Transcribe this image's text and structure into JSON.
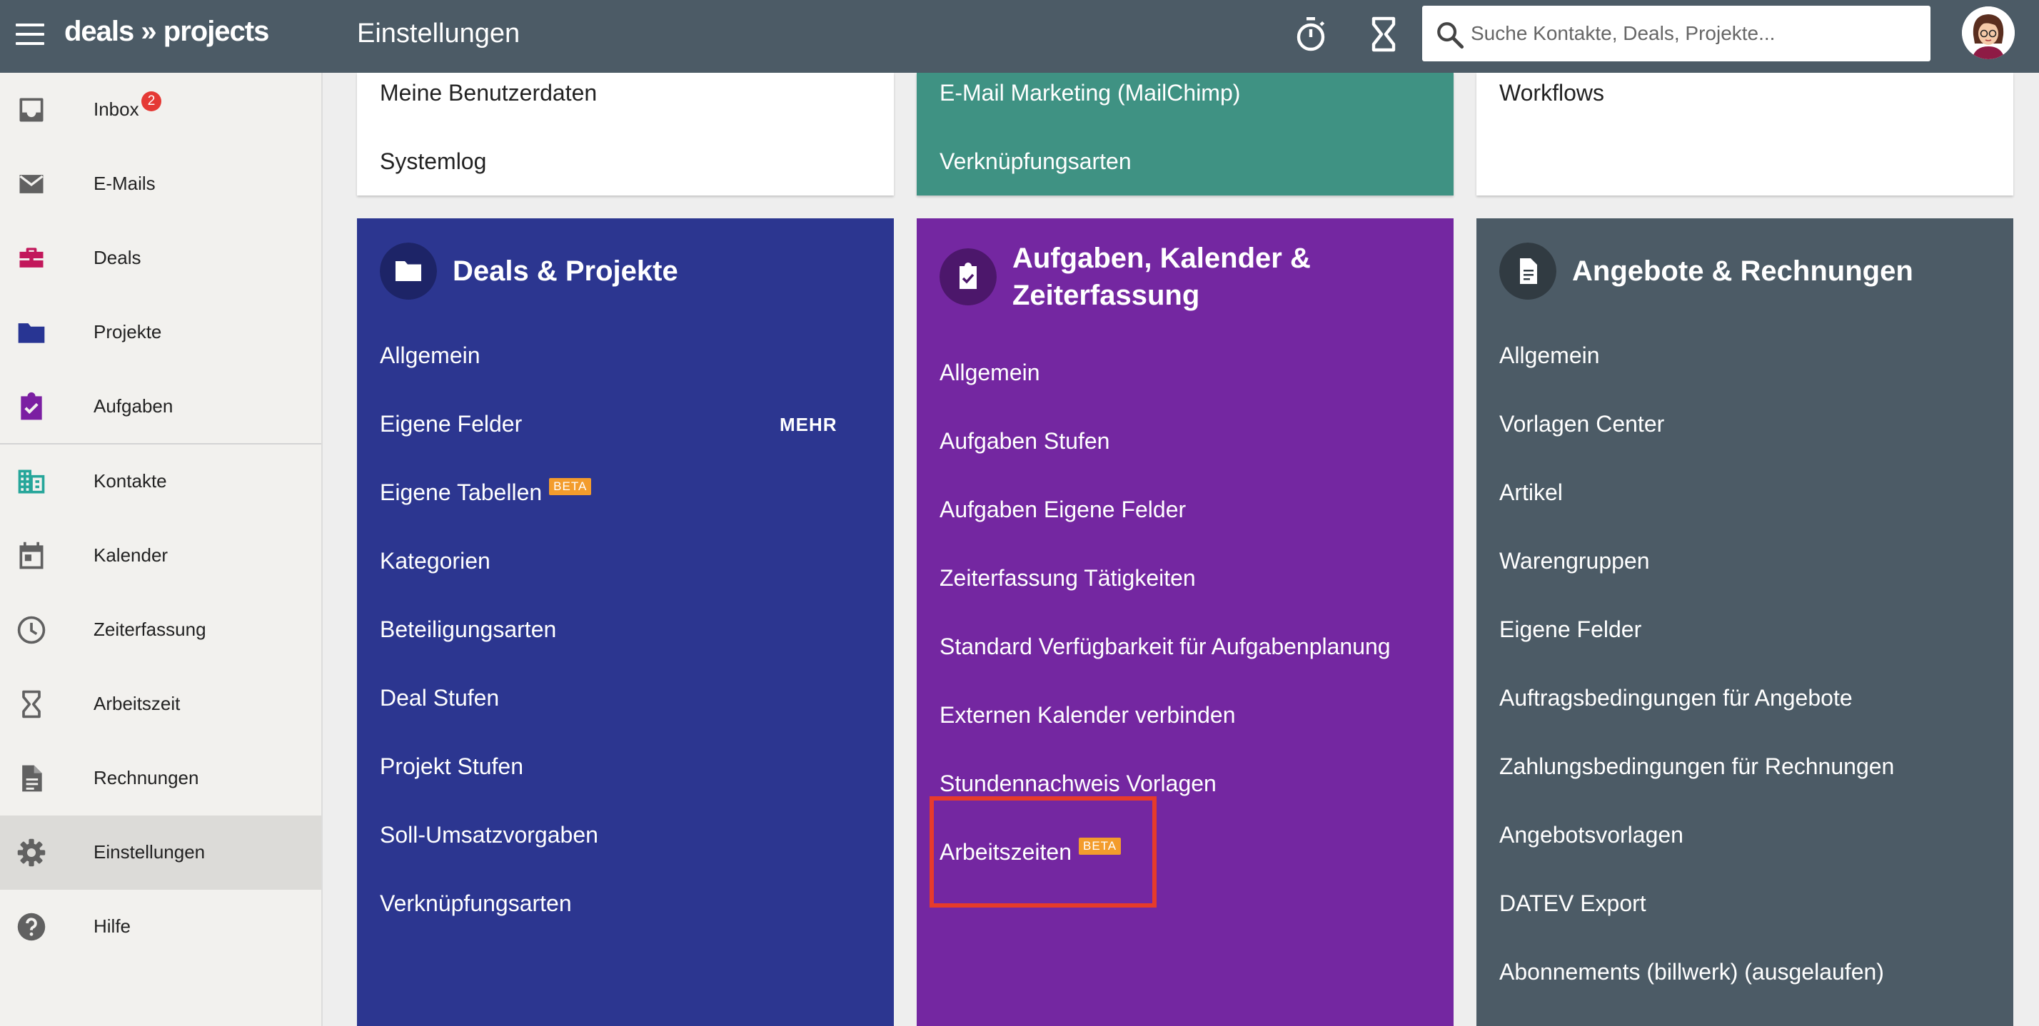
{
  "header": {
    "logo": "deals » projects",
    "title": "Einstellungen",
    "search_placeholder": "Suche Kontakte, Deals, Projekte..."
  },
  "sidebar": {
    "items": [
      {
        "label": "Inbox",
        "icon": "inbox-icon",
        "badge": "2"
      },
      {
        "label": "E-Mails",
        "icon": "mail-icon"
      },
      {
        "label": "Deals",
        "icon": "briefcase-icon"
      },
      {
        "label": "Projekte",
        "icon": "folder-icon"
      },
      {
        "label": "Aufgaben",
        "icon": "task-check-icon"
      },
      {
        "label": "Kontakte",
        "icon": "building-icon"
      },
      {
        "label": "Kalender",
        "icon": "calendar-icon"
      },
      {
        "label": "Zeiterfassung",
        "icon": "clock-icon"
      },
      {
        "label": "Arbeitszeit",
        "icon": "hourglass-icon"
      },
      {
        "label": "Rechnungen",
        "icon": "document-icon"
      },
      {
        "label": "Einstellungen",
        "icon": "gear-icon",
        "active": true
      },
      {
        "label": "Hilfe",
        "icon": "help-icon"
      }
    ]
  },
  "top_cards": {
    "col1": [
      "Meine Benutzerdaten",
      "Systemlog"
    ],
    "col2": [
      "E-Mail Marketing (MailChimp)",
      "Verknüpfungsarten"
    ],
    "col3": [
      "Workflows"
    ]
  },
  "cards": {
    "deals": {
      "title": "Deals & Projekte",
      "icon": "folder-icon",
      "mehr": "MEHR",
      "beta": "BETA",
      "items": [
        "Allgemein",
        "Eigene Felder",
        "Eigene Tabellen",
        "Kategorien",
        "Beteiligungsarten",
        "Deal Stufen",
        "Projekt Stufen",
        "Soll-Umsatzvorgaben",
        "Verknüpfungsarten"
      ]
    },
    "tasks": {
      "title_line1": "Aufgaben, Kalender &",
      "title_line2": "Zeiterfassung",
      "icon": "task-check-icon",
      "beta": "BETA",
      "items": [
        "Allgemein",
        "Aufgaben Stufen",
        "Aufgaben Eigene Felder",
        "Zeiterfassung Tätigkeiten",
        "Standard Verfügbarkeit für Aufgabenplanung",
        "Externen Kalender verbinden",
        "Stundennachweis Vorlagen",
        "Arbeitszeiten"
      ]
    },
    "offers": {
      "title": "Angebote & Rechnungen",
      "icon": "document-icon",
      "items": [
        "Allgemein",
        "Vorlagen Center",
        "Artikel",
        "Warengruppen",
        "Eigene Felder",
        "Auftragsbedingungen für Angebote",
        "Zahlungsbedingungen für Rechnungen",
        "Angebotsvorlagen",
        "DATEV Export",
        "Abonnements (billwerk) (ausgelaufen)"
      ]
    }
  },
  "colors": {
    "topbar": "#4c5b66",
    "deals_card": "#2c3690",
    "tasks_card": "#7427a1",
    "offers_card": "#4c5b66",
    "teal_card": "#3f9283",
    "beta_badge": "#f39c2c",
    "highlight": "#e73b2b"
  }
}
